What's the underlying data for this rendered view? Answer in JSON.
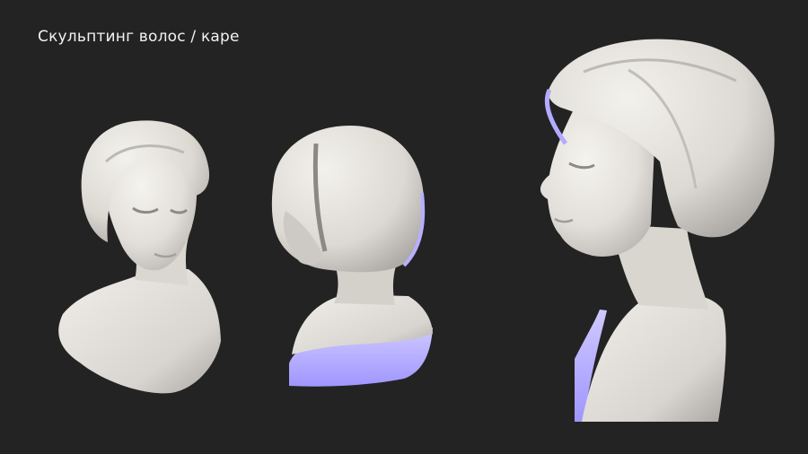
{
  "title": "Скульптинг волос / каре",
  "views": [
    {
      "name": "three-quarter-front"
    },
    {
      "name": "three-quarter-back"
    },
    {
      "name": "profile-closeup"
    }
  ],
  "colors": {
    "background": "#232323",
    "sculpt": "#e9e6e0",
    "sculpt_shade": "#b9b6b2",
    "rim_light": "#b8b0ff",
    "title_text": "#f2f2f2"
  }
}
